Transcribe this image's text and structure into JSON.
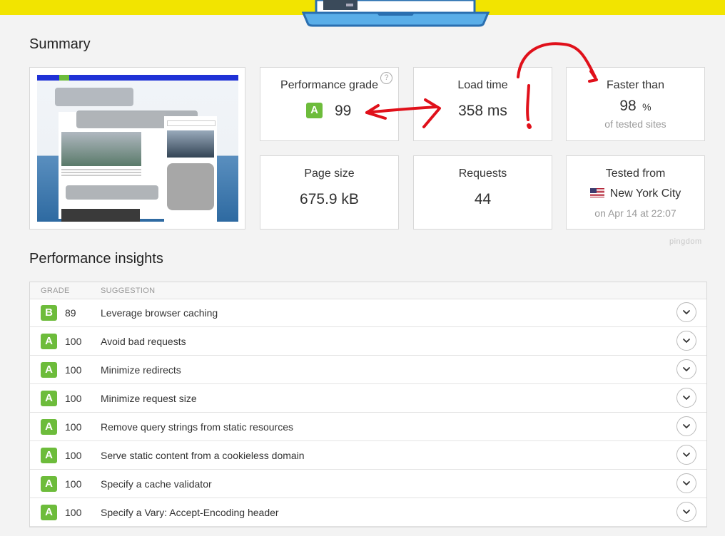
{
  "summary": {
    "title": "Summary",
    "performance_grade": {
      "label": "Performance grade",
      "grade": "A",
      "value": "99",
      "help": "?"
    },
    "load_time": {
      "label": "Load time",
      "value": "358 ms"
    },
    "faster_than": {
      "label": "Faster than",
      "value": "98",
      "unit": "%",
      "sub": "of tested sites"
    },
    "page_size": {
      "label": "Page size",
      "value": "675.9 kB"
    },
    "requests": {
      "label": "Requests",
      "value": "44"
    },
    "tested_from": {
      "label": "Tested from",
      "location": "New York City",
      "date": "on Apr 14 at 22:07"
    },
    "brand": "pingdom"
  },
  "insights": {
    "title": "Performance insights",
    "columns": {
      "grade": "GRADE",
      "suggestion": "SUGGESTION"
    },
    "rows": [
      {
        "grade": "B",
        "score": "89",
        "suggestion": "Leverage browser caching"
      },
      {
        "grade": "A",
        "score": "100",
        "suggestion": "Avoid bad requests"
      },
      {
        "grade": "A",
        "score": "100",
        "suggestion": "Minimize redirects"
      },
      {
        "grade": "A",
        "score": "100",
        "suggestion": "Minimize request size"
      },
      {
        "grade": "A",
        "score": "100",
        "suggestion": "Remove query strings from static resources"
      },
      {
        "grade": "A",
        "score": "100",
        "suggestion": "Serve static content from a cookieless domain"
      },
      {
        "grade": "A",
        "score": "100",
        "suggestion": "Specify a cache validator"
      },
      {
        "grade": "A",
        "score": "100",
        "suggestion": "Specify a Vary: Accept-Encoding header"
      }
    ]
  },
  "colors": {
    "grade_green": "#6dbc3b",
    "annotation_red": "#e0101a",
    "topbar_yellow": "#f2e400"
  }
}
